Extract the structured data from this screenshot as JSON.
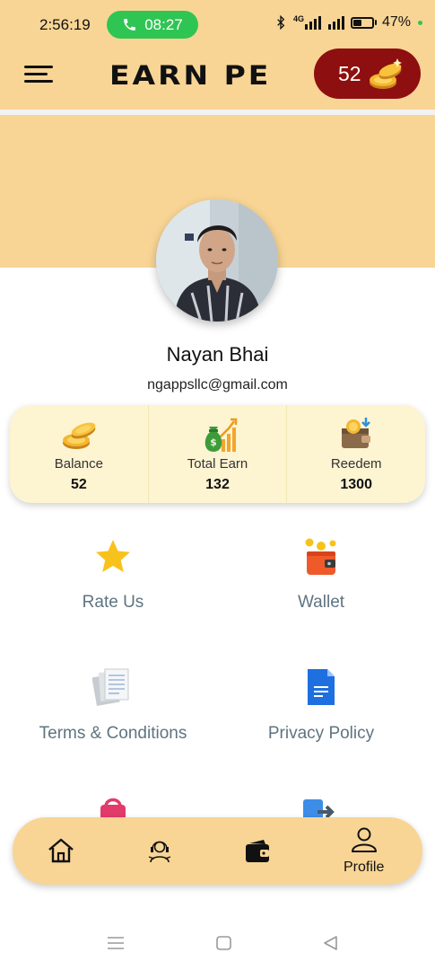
{
  "status_bar": {
    "time": "2:56:19",
    "call_timer": "08:27",
    "battery_percent": "47%",
    "battery_level": 0.47,
    "network_label": "4G",
    "icons": [
      "phone-icon",
      "bluetooth-icon",
      "signal-icon",
      "signal-icon",
      "battery-icon"
    ]
  },
  "header": {
    "title": "EARN PE",
    "coin_count": "52",
    "icons": [
      "hamburger-menu-icon",
      "coins-icon"
    ]
  },
  "profile": {
    "name": "Nayan Bhai",
    "email": "ngappsllc@gmail.com"
  },
  "stats": [
    {
      "label": "Balance",
      "value": "52",
      "icon": "coins-icon"
    },
    {
      "label": "Total Earn",
      "value": "132",
      "icon": "money-bag-growth-icon"
    },
    {
      "label": "Reedem",
      "value": "1300",
      "icon": "wallet-redeem-icon"
    }
  ],
  "menu": [
    {
      "label": "Rate Us",
      "icon": "star-icon"
    },
    {
      "label": "Wallet",
      "icon": "wallet-icon"
    },
    {
      "label": "Terms & Conditions",
      "icon": "documents-icon"
    },
    {
      "label": "Privacy Policy",
      "icon": "document-icon"
    },
    {
      "label": "",
      "icon": "shopping-bag-icon"
    },
    {
      "label": "",
      "icon": "logout-icon"
    }
  ],
  "bottom_nav": {
    "items": [
      {
        "icon": "home-icon"
      },
      {
        "icon": "support-agent-icon"
      },
      {
        "icon": "wallet-icon"
      },
      {
        "icon": "profile-icon",
        "label": "Profile"
      }
    ]
  },
  "colors": {
    "accent": "#f8d595",
    "coin_pill": "#8e0f0f",
    "card": "#fdf4d2",
    "menu_text": "#5f7480",
    "call_green": "#2fc553"
  }
}
